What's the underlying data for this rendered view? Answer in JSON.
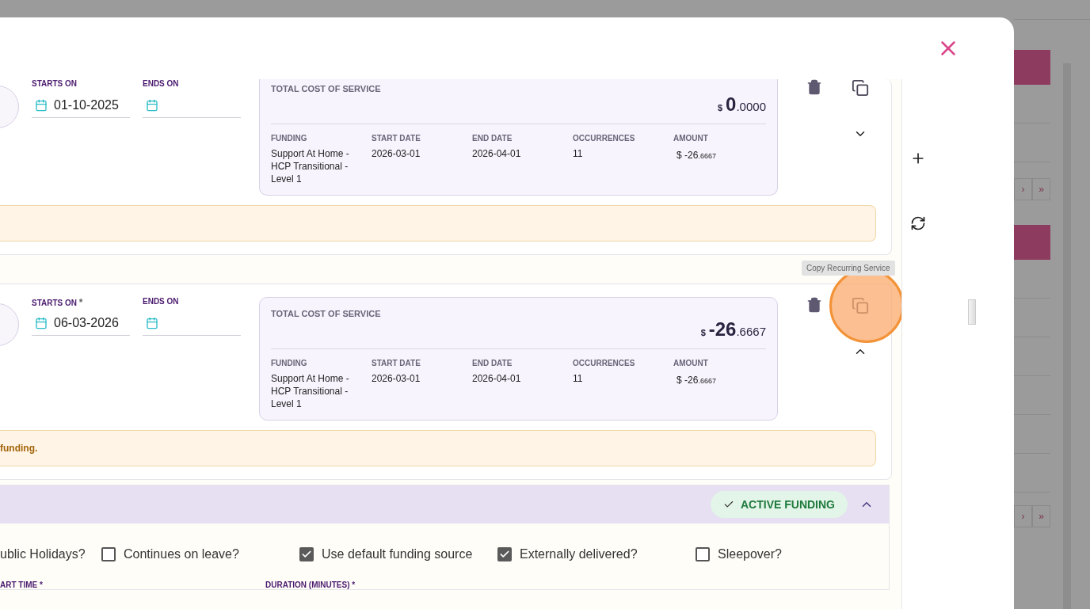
{
  "services": [
    {
      "starts_label": "STARTS ON",
      "starts_on": "01-10-2025",
      "ends_label": "ENDS ON",
      "cost": {
        "title": "TOTAL COST OF SERVICE",
        "currency": "$",
        "whole": "0",
        "fraction": ".0000"
      },
      "columns": [
        "FUNDING",
        "START DATE",
        "END DATE",
        "OCCURRENCES",
        "AMOUNT"
      ],
      "values": [
        "Support At Home - HCP Transitional - Level 1",
        "2026-03-01",
        "2026-04-01",
        "11"
      ],
      "amount": {
        "currency": "$",
        "whole": "-26",
        "fraction": ".6667"
      },
      "expanded": false,
      "highlighted": false
    },
    {
      "starts_label": "STARTS ON",
      "required_mark": "*",
      "starts_on": "06-03-2026",
      "ends_label": "ENDS ON",
      "cost": {
        "title": "TOTAL COST OF SERVICE",
        "currency": "$",
        "whole": "-26",
        "fraction": ".6667"
      },
      "columns": [
        "FUNDING",
        "START DATE",
        "END DATE",
        "OCCURRENCES",
        "AMOUNT"
      ],
      "values": [
        "Support At Home - HCP Transitional - Level 1",
        "2026-03-01",
        "2026-04-01",
        "11"
      ],
      "amount": {
        "currency": "$",
        "whole": "-26",
        "fraction": ".6667"
      },
      "warning": "funding.",
      "expanded": true,
      "highlighted": true,
      "tooltip": "Copy Recurring Service"
    }
  ],
  "funding_section": {
    "badge": "ACTIVE FUNDING",
    "expanded": true,
    "cut_label": "ublic Holidays?",
    "options": [
      {
        "label": "Continues on leave?",
        "checked": false
      },
      {
        "label": "Use default funding source",
        "checked": true
      },
      {
        "label": "Externally delivered?",
        "checked": true
      },
      {
        "label": "Sleepover?",
        "checked": false
      }
    ],
    "field_labels": [
      "ART TIME *",
      "DURATION (MINUTES) *"
    ]
  },
  "background": {
    "paginations": [
      [
        "›",
        "»"
      ],
      [
        "›",
        "»"
      ]
    ]
  }
}
